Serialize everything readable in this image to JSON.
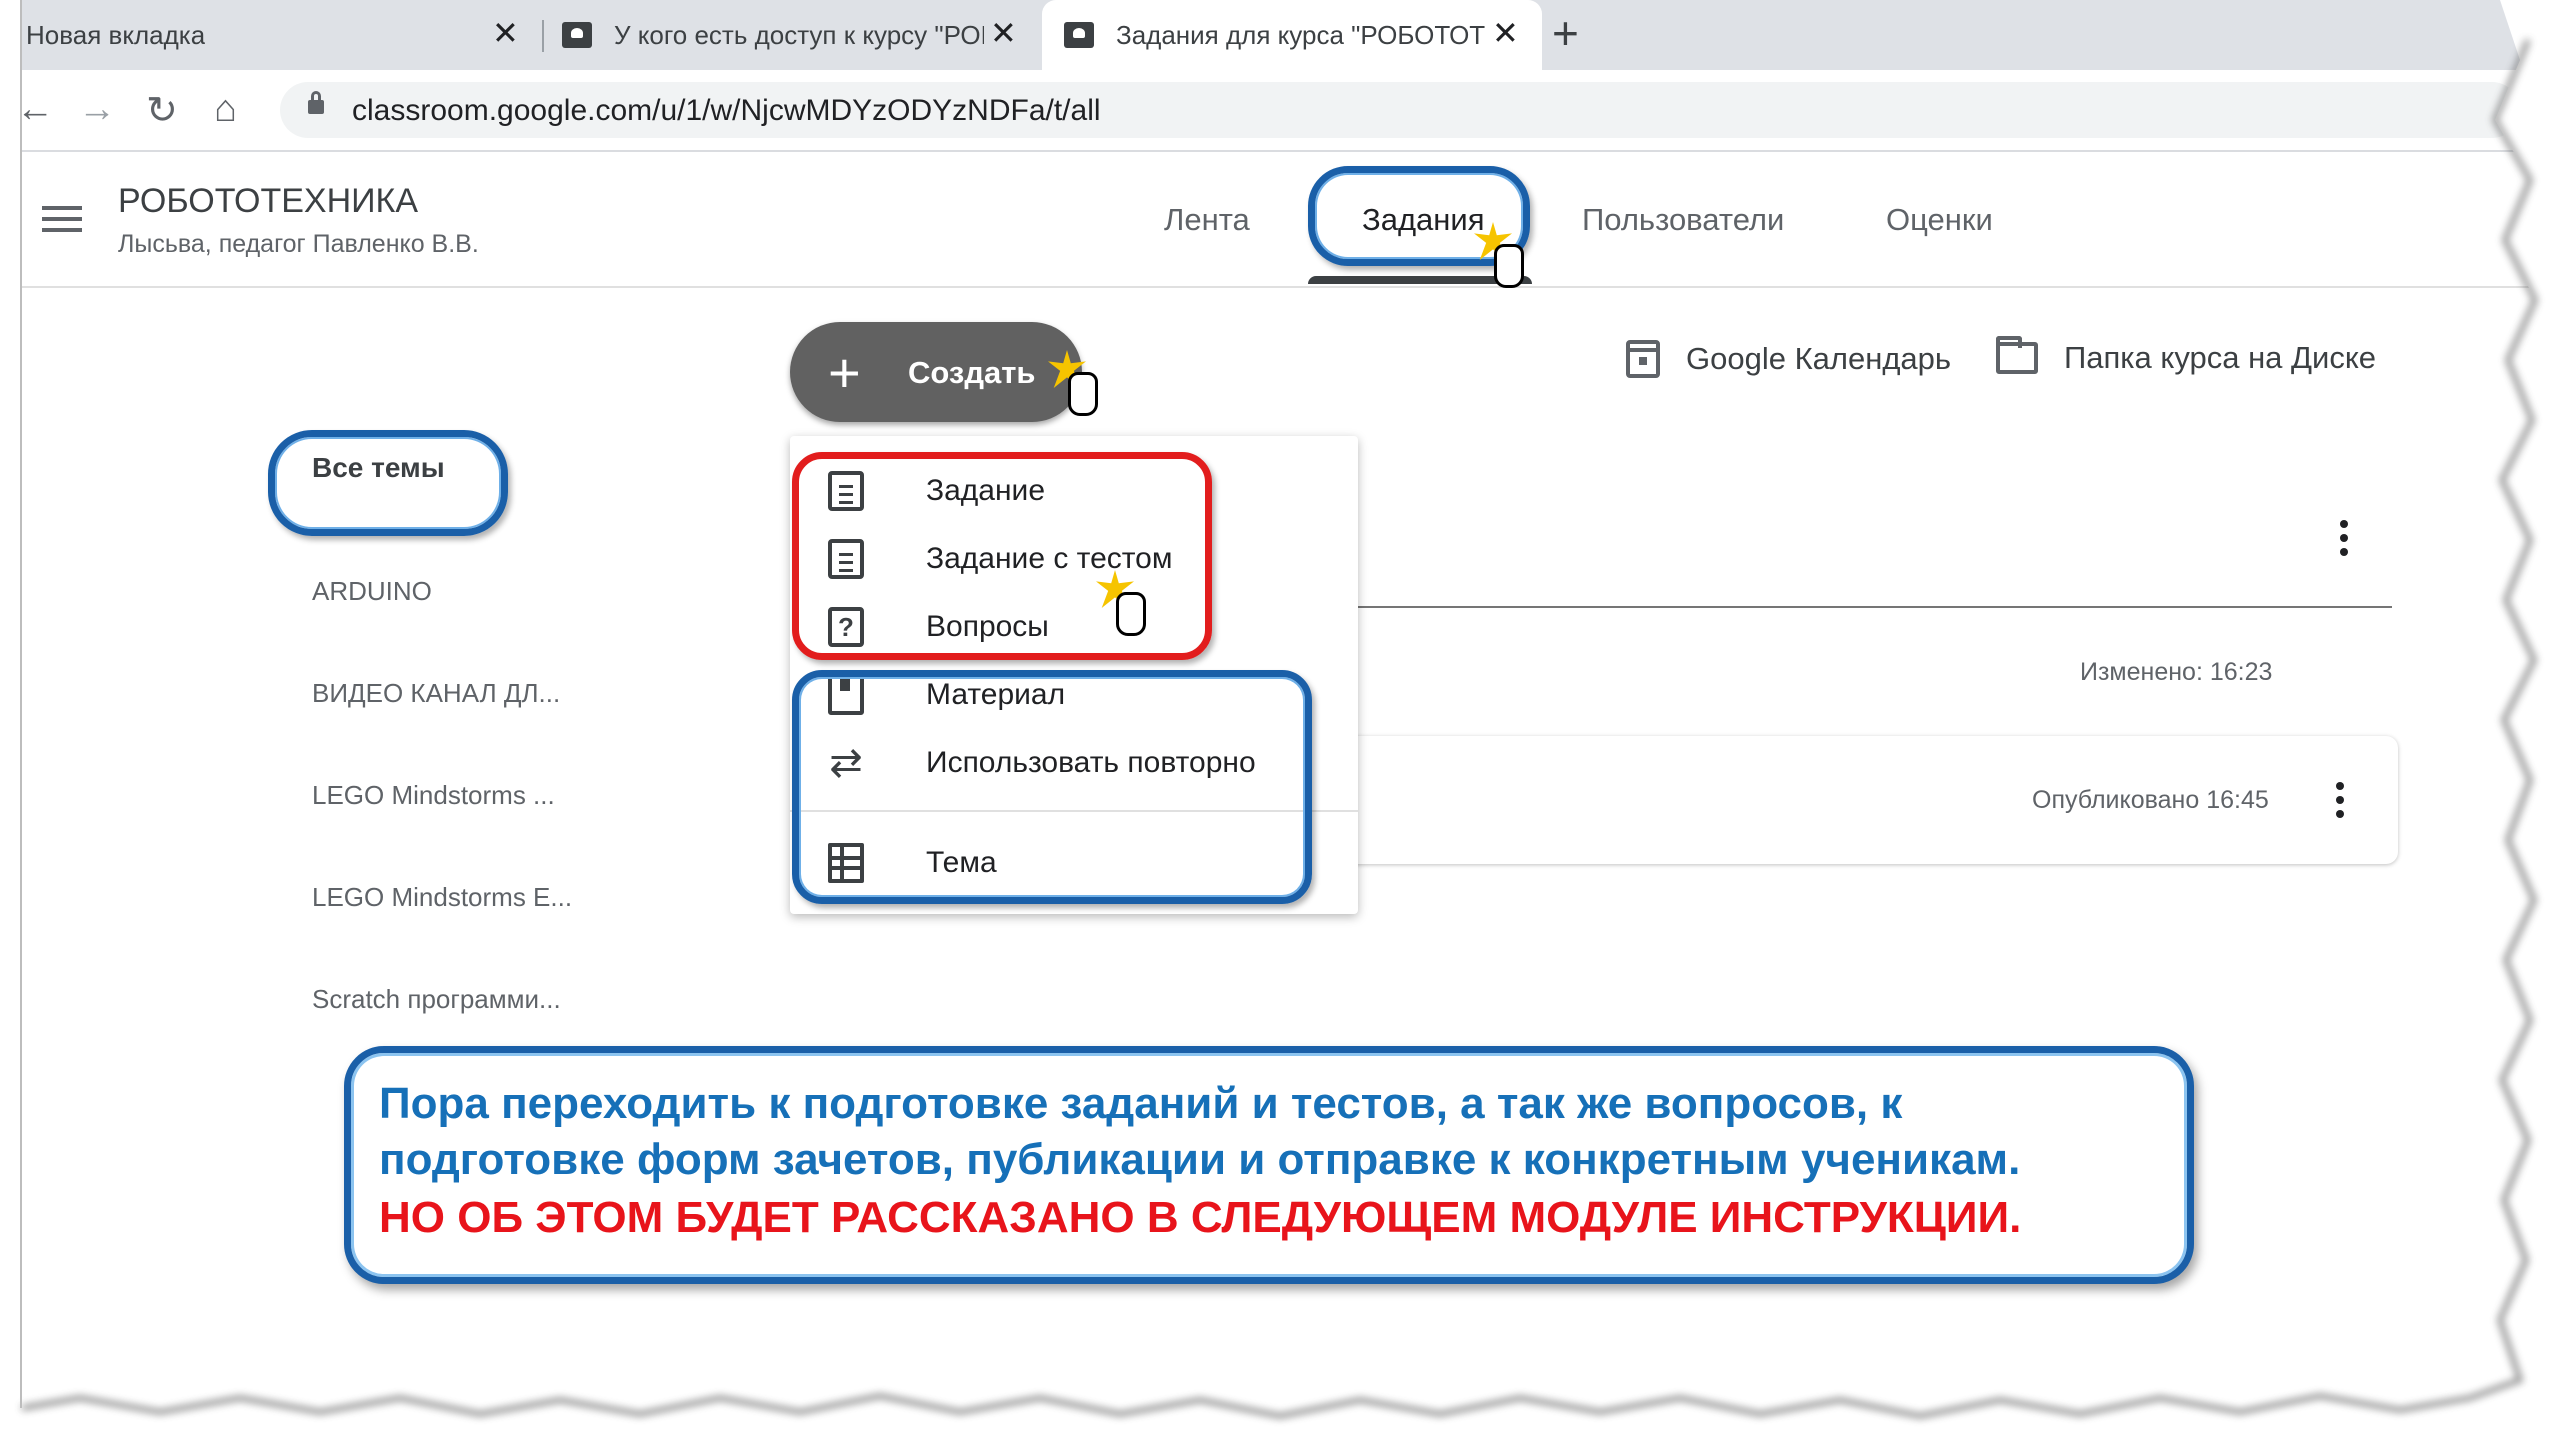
{
  "browser": {
    "tabs": [
      {
        "title": "Новая вкладка",
        "active": false
      },
      {
        "title": "У кого есть доступ к курсу \"РОБ",
        "active": false
      },
      {
        "title": "Задания для курса \"РОБОТОТЕХ",
        "active": true
      }
    ],
    "new_tab_symbol": "+",
    "close_symbol": "✕",
    "url": "classroom.google.com/u/1/w/NjcwMDYzODYzNDFa/t/all"
  },
  "classroom": {
    "course_title": "РОБОТОТЕХНИКА",
    "course_subtitle": "Лысьва, педагог Павленко В.В.",
    "nav_tabs": [
      "Лента",
      "Задания",
      "Пользователи",
      "Оценки"
    ],
    "active_tab": "Задания",
    "create_button": "Создать",
    "calendar_link": "Google Календарь",
    "drive_link": "Папка курса на Диске"
  },
  "topics": {
    "all_label": "Все темы",
    "items": [
      "ARDUINO",
      "ВИДЕО КАНАЛ ДЛ...",
      "LEGO Mindstorms ...",
      "LEGO Mindstorms E...",
      "Scratch программи..."
    ]
  },
  "create_menu": {
    "items": [
      {
        "label": "Задание",
        "icon": "assignment-icon"
      },
      {
        "label": "Задание с тестом",
        "icon": "quiz-assignment-icon"
      },
      {
        "label": "Вопросы",
        "icon": "question-icon"
      },
      {
        "label": "Материал",
        "icon": "material-icon"
      },
      {
        "label": "Использовать повторно",
        "icon": "reuse-icon"
      },
      {
        "label": "Тема",
        "icon": "topic-icon"
      }
    ]
  },
  "stream": {
    "modified": "Изменено: 16:23",
    "published": "Опубликовано 16:45"
  },
  "note": {
    "line1": "Пора переходить к подготовке заданий и тестов, а так же вопросов, к",
    "line2": "подготовке форм зачетов, публикации и отправке к конкретным ученикам.",
    "line3": "НО ОБ ЭТОМ БУДЕТ РАССКАЗАНО В СЛЕДУЮЩЕМ МОДУЛЕ ИНСТРУКЦИИ."
  },
  "colors": {
    "highlight_blue": "#1a5fa8",
    "highlight_red": "#e21d1d",
    "note_blue_text": "#1670b8",
    "note_red_text": "#e8141b"
  }
}
